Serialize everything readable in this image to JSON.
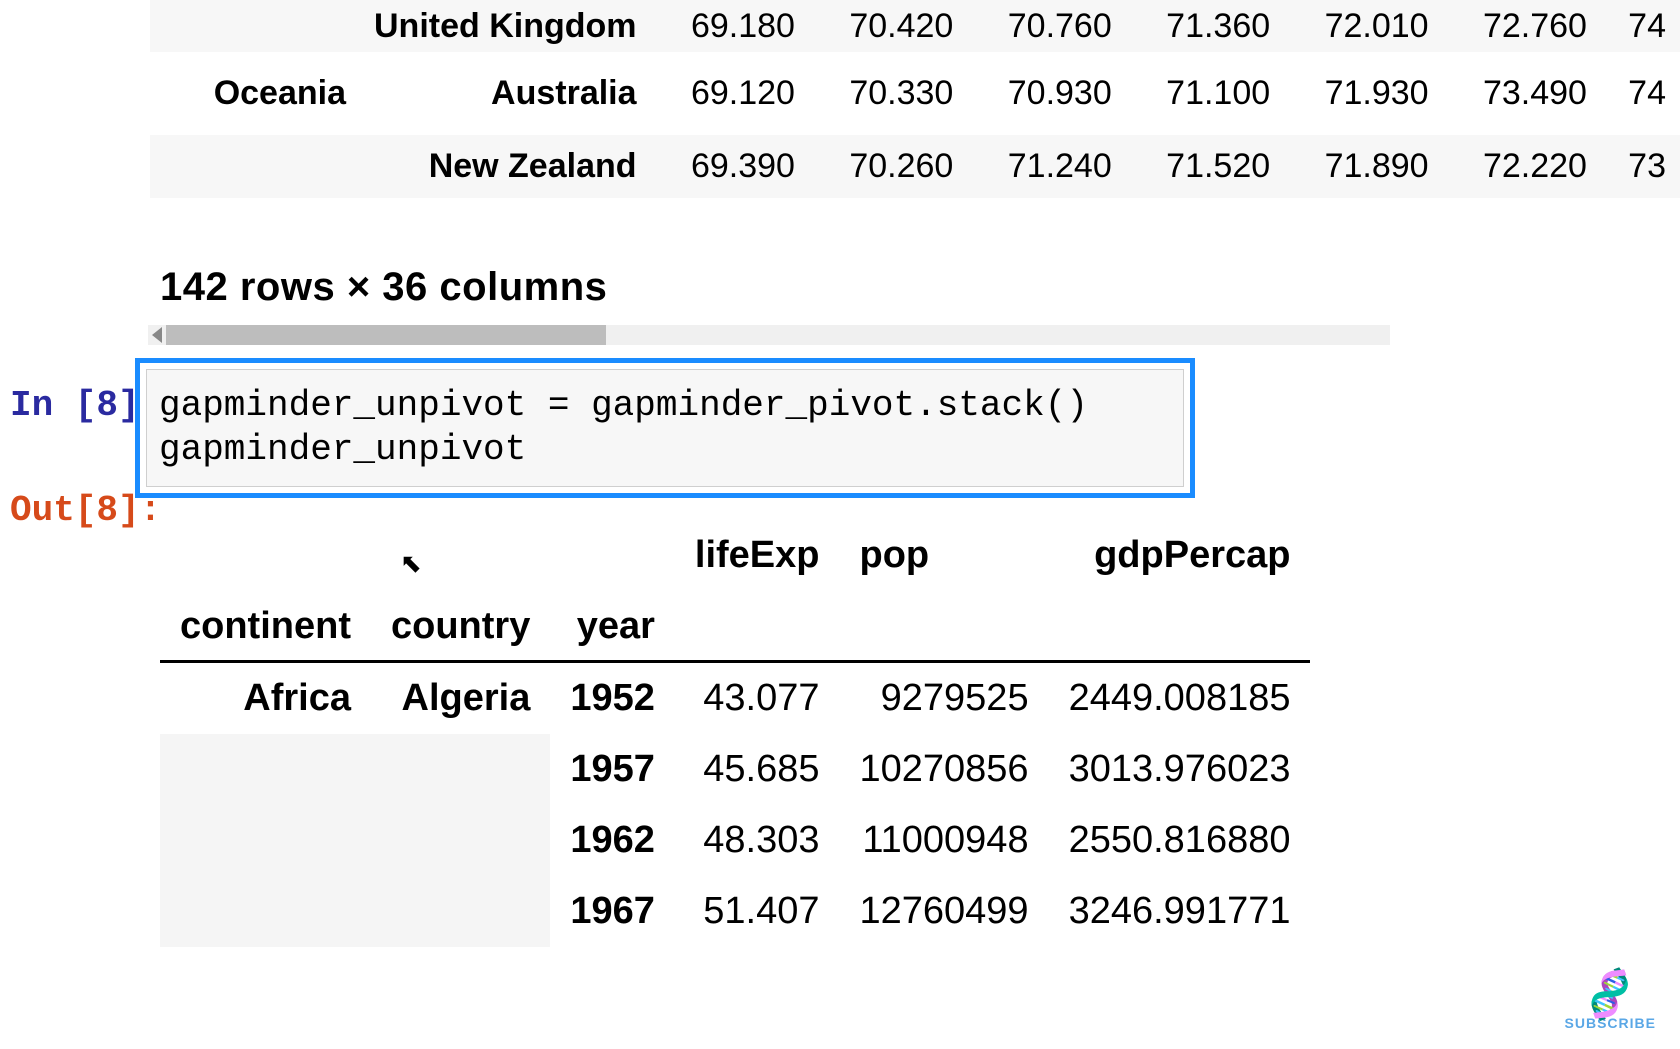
{
  "top_table": {
    "rows": [
      {
        "continent": "",
        "country": "United Kingdom",
        "vals": [
          "69.180",
          "70.420",
          "70.760",
          "71.360",
          "72.010",
          "72.760",
          "74"
        ]
      },
      {
        "continent": "Oceania",
        "country": "Australia",
        "vals": [
          "69.120",
          "70.330",
          "70.930",
          "71.100",
          "71.930",
          "73.490",
          "74"
        ]
      },
      {
        "continent": "",
        "country": "New Zealand",
        "vals": [
          "69.390",
          "70.260",
          "71.240",
          "71.520",
          "71.890",
          "72.220",
          "73"
        ]
      }
    ]
  },
  "dim_text": "142 rows × 36 columns",
  "in_label": "In [8]:",
  "out_label": "Out[8]:",
  "code": "gapminder_unpivot = gapminder_pivot.stack()\ngapminder_unpivot",
  "out_table": {
    "headers1": [
      "",
      "",
      "",
      "lifeExp",
      "pop",
      "gdpPercap"
    ],
    "headers2": [
      "continent",
      "country",
      "year",
      "",
      "",
      ""
    ],
    "rows": [
      {
        "continent": "Africa",
        "country": "Algeria",
        "year": "1952",
        "lifeExp": "43.077",
        "pop": "9279525",
        "gdpPercap": "2449.008185"
      },
      {
        "continent": "",
        "country": "",
        "year": "1957",
        "lifeExp": "45.685",
        "pop": "10270856",
        "gdpPercap": "3013.976023"
      },
      {
        "continent": "",
        "country": "",
        "year": "1962",
        "lifeExp": "48.303",
        "pop": "11000948",
        "gdpPercap": "2550.816880"
      },
      {
        "continent": "",
        "country": "",
        "year": "1967",
        "lifeExp": "51.407",
        "pop": "12760499",
        "gdpPercap": "3246.991771"
      }
    ]
  },
  "subscribe": {
    "icon": "🧬",
    "label": "SUBSCRIBE"
  }
}
